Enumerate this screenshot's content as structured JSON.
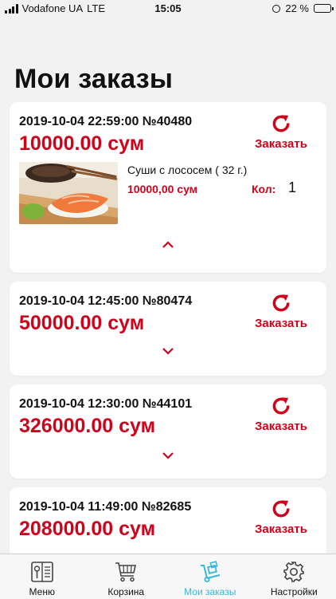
{
  "status_bar": {
    "carrier": "Vodafone UA",
    "network": "LTE",
    "time": "15:05",
    "battery": "22 %",
    "battery_level": 0.22
  },
  "page": {
    "title": "Мои заказы"
  },
  "orders": [
    {
      "meta": "2019-10-04 22:59:00 №40480",
      "total": "10000.00 сум",
      "reorder_label": "Заказать",
      "expanded": true,
      "items": [
        {
          "name": "Суши с лососем ( 32 г.)",
          "price": "10000,00 сум",
          "qty_label": "Кол:",
          "qty": "1"
        }
      ]
    },
    {
      "meta": "2019-10-04 12:45:00 №80474",
      "total": "50000.00 сум",
      "reorder_label": "Заказать",
      "expanded": false
    },
    {
      "meta": "2019-10-04 12:30:00 №44101",
      "total": "326000.00 сум",
      "reorder_label": "Заказать",
      "expanded": false
    },
    {
      "meta": "2019-10-04 11:49:00 №82685",
      "total": "208000.00 сум",
      "reorder_label": "Заказать",
      "expanded": false
    }
  ],
  "tabs": [
    {
      "label": "Меню",
      "icon": "menu-book-icon",
      "active": false
    },
    {
      "label": "Корзина",
      "icon": "cart-icon",
      "active": false
    },
    {
      "label": "Мои заказы",
      "icon": "hand-truck-icon",
      "active": true
    },
    {
      "label": "Настройки",
      "icon": "gear-icon",
      "active": false
    }
  ],
  "colors": {
    "accent": "#d0021b",
    "tab_active": "#36b7dd",
    "background": "#f2f2f2"
  }
}
